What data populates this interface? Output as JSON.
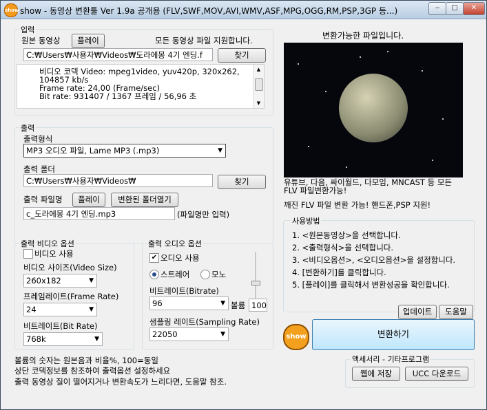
{
  "window": {
    "app_icon_text": "show",
    "title": "show - 동영상 변환툴 Ver 1.9a 공개용 (FLV,SWF,MOV,AVI,WMV,ASF,MPG,OGG,RM,PSP,3GP 등...)",
    "minimize": "‒",
    "maximize": "□",
    "close": "✕"
  },
  "input": {
    "group_title": "입력",
    "source_label": "원본 동영상",
    "play_button": "플레이",
    "support_text": "모든 동영상 파일 지원합니다.",
    "path": "C:₩Users₩사용자₩Videos₩도라에몽 4기 엔딩.f",
    "browse_button": "찾기",
    "info_lines": [
      "비디오 코덱 Video: mpeg1video, yuv420p, 320x262,",
      "104857 kb/s",
      "Frame rate: 24,00 (Frame/sec)",
      "Bit rate: 931407 / 1367 프레임 / 56,96 초"
    ]
  },
  "output": {
    "group_title": "출력",
    "format_label": "출력형식",
    "format_value": "MP3 오디오 파일, Lame MP3  (.mp3)",
    "folder_label": "출력 폴더",
    "folder_value": "C:₩Users₩사용자₩Videos₩",
    "folder_browse": "찾기",
    "filename_label": "출력 파일명",
    "play_button": "플레이",
    "open_folder_button": "변환된 폴더열기",
    "filename_value": "c_도라에몽 4기 엔딩.mp3",
    "filename_hint": "(파일명만 입력)"
  },
  "video_options": {
    "group_title": "출력 비디오 옵션",
    "use_video": "비디오 사용",
    "use_video_checked": false,
    "size_label": "비디오 사이즈(Video Size)",
    "size_value": "260x182",
    "framerate_label": "프레임레이트(Frame Rate)",
    "framerate_value": "24",
    "bitrate_label": "비트레이트(Bit Rate)",
    "bitrate_value": "768k"
  },
  "audio_options": {
    "group_title": "출력 오디오 옵션",
    "use_audio": "오디오 사용",
    "use_audio_checked": true,
    "stereo": "스트레어",
    "mono": "모노",
    "bitrate_label": "비트레이트(Bitrate)",
    "bitrate_value": "96",
    "volume_label": "볼륨",
    "volume_value": "100",
    "sampling_label": "샘플링 레이트(Sampling Rate)",
    "sampling_value": "22050"
  },
  "preview": {
    "caption": "변환가능한 파일입니다.",
    "promo_line1": "유튜브, 다음, 싸이월드, 다모임, MNCAST 등 모든",
    "promo_line2": "FLV 파일변환가능!",
    "promo_line3": "깨진 FLV 파일 변환 가능!      핸드폰,PSP 지원!"
  },
  "usage": {
    "group_title": "사용방법",
    "steps": [
      "1. <원본동영상>을 선택합니다.",
      "2. <출력형식>을 선택합니다.",
      "3. <비디오옵션>, <오디오옵션>을 설정합니다.",
      "4. [변환하기]를 클릭합니다.",
      "5. [플레이]를 클릭해서 변환성공을 확인합니다."
    ]
  },
  "actions": {
    "update_button": "업데이트",
    "help_button": "도움말",
    "convert_button": "변환하기",
    "logo_text": "show"
  },
  "notes": [
    "볼륨의 숫자는 원본음과 비율%, 100=동일",
    "상단 코덱정보를 참조하여 출력옵션 설정하세요",
    "출력 동영상 질이 떨어지거나 변환속도가 느리다면, 도움말 참조."
  ],
  "accessories": {
    "group_title": "액세서리 - 기타프로그램",
    "web_save": "웹에 저장",
    "ucc_download": "UCC 다운로드"
  }
}
